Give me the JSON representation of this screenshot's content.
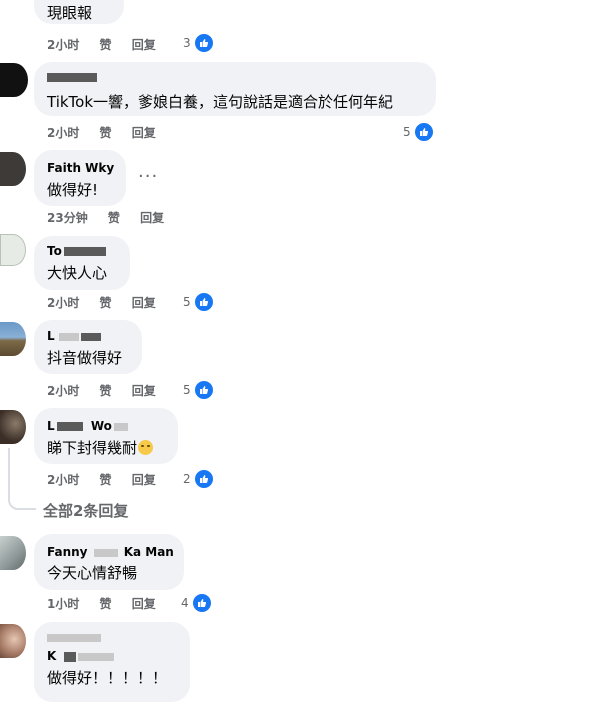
{
  "actions": {
    "like": "赞",
    "reply": "回复"
  },
  "comments": [
    {
      "text": "現眼報",
      "time": "2小时",
      "reactions": "3"
    },
    {
      "name": "",
      "text": "TikTok一響，爹娘白養，這句說話是適合於任何年紀",
      "time": "2小时",
      "reactions": "5"
    },
    {
      "name": "Faith Wky",
      "text": "做得好!",
      "time": "23分钟",
      "more": "···"
    },
    {
      "name": "To",
      "text": "大快人心",
      "time": "2小时",
      "reactions": "5"
    },
    {
      "name": "L",
      "text": "抖音做得好",
      "time": "2小时",
      "reactions": "5"
    },
    {
      "name": "L",
      "name_suffix": "Wo",
      "text": "睇下封得幾耐",
      "time": "2小时",
      "reactions": "2"
    },
    {
      "name": "Fanny",
      "name_suffix": "Ka Man",
      "text": "今天心情舒暢",
      "time": "1小时",
      "reactions": "4"
    },
    {
      "name": "K",
      "text": "做得好！！！！！"
    }
  ],
  "view_replies": "全部2条回复",
  "icons": {
    "like": "like-icon",
    "more": "more-options-icon",
    "emoji": "emoji-icon"
  },
  "colors": {
    "accent": "#1877f2",
    "bubble": "#f0f2f5",
    "meta": "#65676b"
  }
}
